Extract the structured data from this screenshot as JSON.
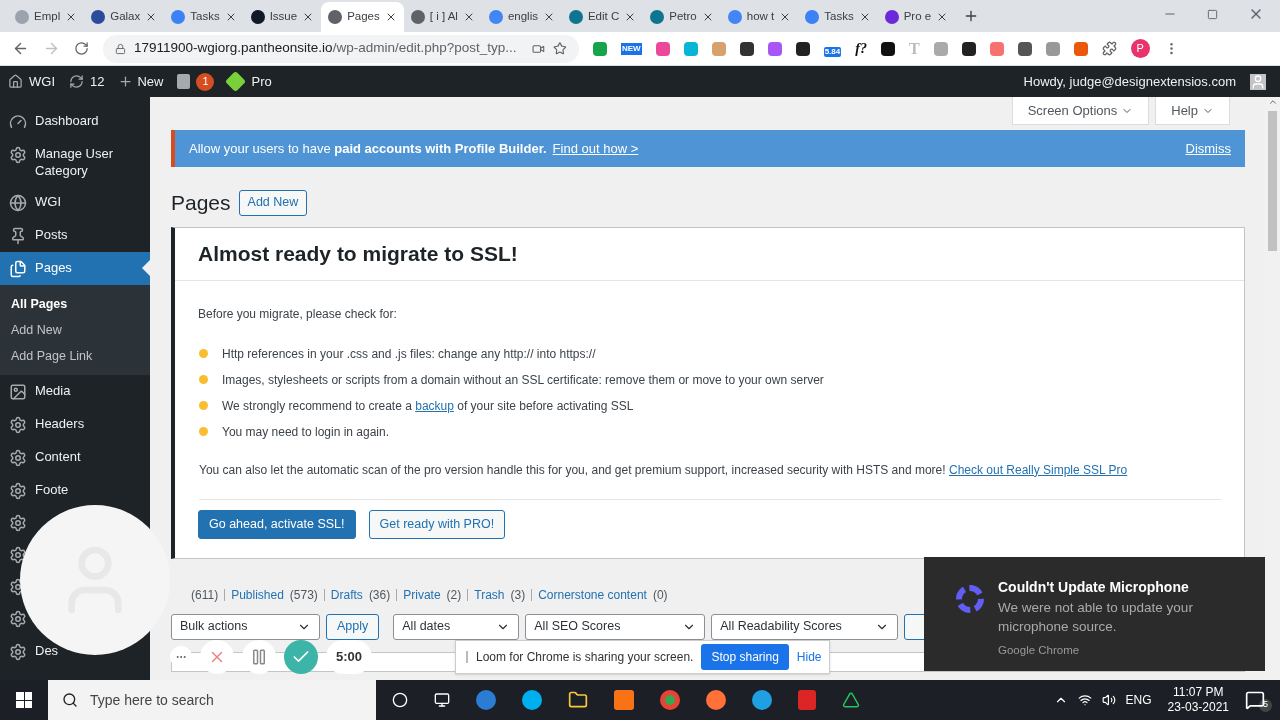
{
  "browser": {
    "tabs": [
      {
        "title": "Empl",
        "selected": false
      },
      {
        "title": "Galax",
        "selected": false
      },
      {
        "title": "Tasks",
        "selected": false
      },
      {
        "title": "Issue",
        "selected": false
      },
      {
        "title": "Pages",
        "selected": true
      },
      {
        "title": "[ i ] Al",
        "selected": false
      },
      {
        "title": "englis",
        "selected": false
      },
      {
        "title": "Edit C",
        "selected": false
      },
      {
        "title": "Petro",
        "selected": false
      },
      {
        "title": "how t",
        "selected": false
      },
      {
        "title": "Tasks",
        "selected": false
      },
      {
        "title": "Pro e",
        "selected": false
      }
    ],
    "address": {
      "host": "17911900-wgiorg.pantheonsite.io",
      "path": "/wp-admin/edit.php?post_typ..."
    },
    "toolbar_texts": {
      "new_badge": "NEW",
      "speed_badge": "5.84",
      "formula": "f?",
      "letter": "T"
    },
    "profile": "P"
  },
  "admin_bar": {
    "site": "WGI",
    "updates": "12",
    "new": "New",
    "seo_count": "1",
    "pro": "Pro",
    "greeting": "Howdy, judge@designextensios.com"
  },
  "sidebar": {
    "items": [
      {
        "label": "Dashboard",
        "selected": false
      },
      {
        "label": "Manage User Category",
        "selected": false
      },
      {
        "label": "WGI",
        "selected": false
      },
      {
        "label": "Posts",
        "selected": false
      },
      {
        "label": "Pages",
        "selected": true,
        "children": [
          {
            "label": "All Pages",
            "selected": true
          },
          {
            "label": "Add New",
            "selected": false
          },
          {
            "label": "Add Page Link",
            "selected": false
          }
        ]
      },
      {
        "label": "Media",
        "selected": false
      },
      {
        "label": "Headers",
        "selected": false
      },
      {
        "label": "Content",
        "selected": false
      },
      {
        "label": "Foote",
        "selected": false
      },
      {
        "kind": "covered"
      },
      {
        "kind": "covered"
      },
      {
        "kind": "covered"
      },
      {
        "kind": "covered"
      },
      {
        "label": "Des",
        "selected": false
      }
    ]
  },
  "screen_tabs": [
    "Screen Options",
    "Help"
  ],
  "notice": {
    "text": "Allow your users to have **paid accounts with Profile Builder.**",
    "link": "Find out how >",
    "dismiss": "Dismiss"
  },
  "page": {
    "title": "Pages",
    "add_new": "Add New"
  },
  "ssl_box": {
    "title": "Almost ready to migrate to SSL!",
    "intro": "Before you migrate, please check for:",
    "checks": [
      {
        "text": "Http references in your .css and .js files: change any http:// into https://"
      },
      {
        "text": "Images, stylesheets or scripts from a domain without an SSL certificate: remove them or move to your own server"
      },
      {
        "text": "We strongly recommend to create a ",
        "link": "backup",
        "after": " of your site before activating SSL"
      },
      {
        "text": "You may need to login in again."
      }
    ],
    "footer": {
      "text": "You can also let the automatic scan of the pro version handle this for you, and get premium support, increased security with HSTS and more!",
      "link": "Check out Really Simple SSL Pro"
    },
    "buttons": [
      {
        "label": "Go ahead, activate SSL!",
        "kind": "primary"
      },
      {
        "label": "Get ready with PRO!",
        "kind": "secondary"
      }
    ]
  },
  "status_links": [
    {
      "count": "(611)"
    },
    {
      "label": "Published",
      "count": "(573)"
    },
    {
      "label": "Drafts",
      "count": "(36)"
    },
    {
      "label": "Private",
      "count": "(2)"
    },
    {
      "label": "Trash",
      "count": "(3)"
    },
    {
      "label": "Cornerstone content",
      "count": "(0)"
    }
  ],
  "filters": {
    "bulk": "Bulk actions",
    "apply": "Apply",
    "selects": [
      "All dates",
      "All SEO Scores",
      "All Readability Scores"
    ]
  },
  "loom": {
    "timer": "5:00",
    "share_text": "Loom for Chrome is sharing your screen.",
    "stop": "Stop sharing",
    "hide": "Hide"
  },
  "toast": {
    "title": "Couldn't Update Microphone",
    "body": "We were not able to update your microphone source.",
    "source": "Google Chrome"
  },
  "taskbar": {
    "search_placeholder": "Type here to search",
    "language": "ENG",
    "time": "11:07 PM",
    "date": "23-03-2021",
    "notifications": "5"
  }
}
